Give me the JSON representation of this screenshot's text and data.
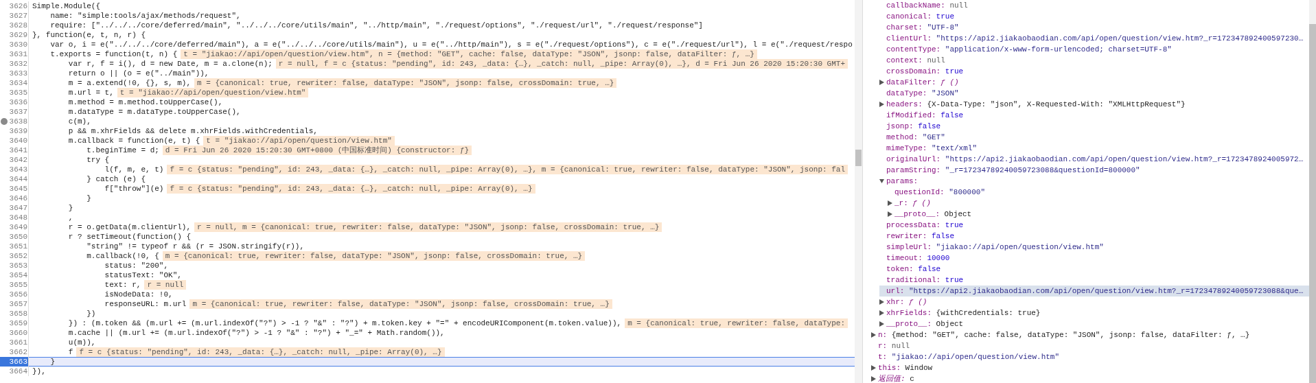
{
  "editor": {
    "lines": [
      {
        "number": "3626",
        "code": "Simple.Module({",
        "breakpoint": false,
        "current": false
      },
      {
        "number": "3627",
        "code": "    name: \"simple:tools/ajax/methods/request\",",
        "breakpoint": false,
        "current": false
      },
      {
        "number": "3628",
        "code": "    require: [\"../../../core/deferred/main\", \"../../../core/utils/main\", \"../http/main\", \"./request/options\", \"./request/url\", \"./request/response\"]",
        "breakpoint": false,
        "current": false
      },
      {
        "number": "3629",
        "code": "}, function(e, t, n, r) {",
        "breakpoint": false,
        "current": false
      },
      {
        "number": "3630",
        "code": "    var o, i = e(\"../../../core/deferred/main\"), a = e(\"../../../core/utils/main\"), u = e(\"../http/main\"), s = e(\"./request/options\"), c = e(\"./request/url\"), l = e(\"./request/respo",
        "breakpoint": false,
        "current": false
      },
      {
        "number": "3631",
        "code": "    t.exports = function(t, n) {",
        "note": "t = \"jiakao://api/open/question/view.htm\", n = {method: \"GET\", cache: false, dataType: \"JSON\", jsonp: false, dataFilter: ƒ, …}",
        "breakpoint": false,
        "current": false
      },
      {
        "number": "3632",
        "code": "        var r, f = i(), d = new Date, m = a.clone(n);",
        "note": "r = null, f = c {status: \"pending\", id: 243, _data: {…}, _catch: null, _pipe: Array(0), …}, d = Fri Jun 26 2020 15:20:30 GMT+",
        "breakpoint": false,
        "current": false
      },
      {
        "number": "3633",
        "code": "        return o || (o = e(\"../main\")),",
        "breakpoint": false,
        "current": false
      },
      {
        "number": "3634",
        "code": "        m = a.extend(!0, {}, s, m),",
        "note": "m = {canonical: true, rewriter: false, dataType: \"JSON\", jsonp: false, crossDomain: true, …}",
        "breakpoint": false,
        "current": false
      },
      {
        "number": "3635",
        "code": "        m.url = t,",
        "note": "t = \"jiakao://api/open/question/view.htm\"",
        "breakpoint": false,
        "current": false
      },
      {
        "number": "3636",
        "code": "        m.method = m.method.toUpperCase(),",
        "breakpoint": false,
        "current": false
      },
      {
        "number": "3637",
        "code": "        m.dataType = m.dataType.toUpperCase(),",
        "breakpoint": false,
        "current": false
      },
      {
        "number": "3638",
        "code": "        c(m),",
        "breakpoint": true,
        "current": false
      },
      {
        "number": "3639",
        "code": "        p && m.xhrFields && delete m.xhrFields.withCredentials,",
        "breakpoint": false,
        "current": false
      },
      {
        "number": "3640",
        "code": "        m.callback = function(e, t) {",
        "note": "t = \"jiakao://api/open/question/view.htm\"",
        "breakpoint": false,
        "current": false
      },
      {
        "number": "3641",
        "code": "            t.beginTime = d;",
        "note": "d = Fri Jun 26 2020 15:20:30 GMT+0800 (中国标准时间) {constructor: ƒ}",
        "breakpoint": false,
        "current": false
      },
      {
        "number": "3642",
        "code": "            try {",
        "breakpoint": false,
        "current": false
      },
      {
        "number": "3643",
        "code": "                l(f, m, e, t)",
        "note": "f = c {status: \"pending\", id: 243, _data: {…}, _catch: null, _pipe: Array(0), …}, m = {canonical: true, rewriter: false, dataType: \"JSON\", jsonp: fal",
        "breakpoint": false,
        "current": false
      },
      {
        "number": "3644",
        "code": "            } catch (e) {",
        "breakpoint": false,
        "current": false
      },
      {
        "number": "3645",
        "code": "                f[\"throw\"](e)",
        "note": "f = c {status: \"pending\", id: 243, _data: {…}, _catch: null, _pipe: Array(0), …}",
        "breakpoint": false,
        "current": false
      },
      {
        "number": "3646",
        "code": "            }",
        "breakpoint": false,
        "current": false
      },
      {
        "number": "3647",
        "code": "        }",
        "breakpoint": false,
        "current": false
      },
      {
        "number": "3648",
        "code": "        ,",
        "breakpoint": false,
        "current": false
      },
      {
        "number": "3649",
        "code": "        r = o.getData(m.clientUrl),",
        "note": "r = null, m = {canonical: true, rewriter: false, dataType: \"JSON\", jsonp: false, crossDomain: true, …}",
        "breakpoint": false,
        "current": false
      },
      {
        "number": "3650",
        "code": "        r ? setTimeout(function() {",
        "breakpoint": false,
        "current": false
      },
      {
        "number": "3651",
        "code": "            \"string\" != typeof r && (r = JSON.stringify(r)),",
        "breakpoint": false,
        "current": false
      },
      {
        "number": "3652",
        "code": "            m.callback(!0, {",
        "note": "m = {canonical: true, rewriter: false, dataType: \"JSON\", jsonp: false, crossDomain: true, …}",
        "breakpoint": false,
        "current": false
      },
      {
        "number": "3653",
        "code": "                status: \"200\",",
        "breakpoint": false,
        "current": false
      },
      {
        "number": "3654",
        "code": "                statusText: \"OK\",",
        "breakpoint": false,
        "current": false
      },
      {
        "number": "3655",
        "code": "                text: r,",
        "note": "r = null",
        "breakpoint": false,
        "current": false
      },
      {
        "number": "3656",
        "code": "                isNodeData: !0,",
        "breakpoint": false,
        "current": false
      },
      {
        "number": "3657",
        "code": "                responseURL: m.url",
        "note": "m = {canonical: true, rewriter: false, dataType: \"JSON\", jsonp: false, crossDomain: true, …}",
        "breakpoint": false,
        "current": false
      },
      {
        "number": "3658",
        "code": "            })",
        "breakpoint": false,
        "current": false
      },
      {
        "number": "3659",
        "code": "        }) : (m.token && (m.url += (m.url.indexOf(\"?\") > -1 ? \"&\" : \"?\") + m.token.key + \"=\" + encodeURIComponent(m.token.value)),",
        "note": "m = {canonical: true, rewriter: false, dataType:",
        "breakpoint": false,
        "current": false
      },
      {
        "number": "3660",
        "code": "        m.cache || (m.url += (m.url.indexOf(\"?\") > -1 ? \"&\" : \"?\") + \"_=\" + Math.random()),",
        "breakpoint": false,
        "current": false
      },
      {
        "number": "3661",
        "code": "        u(m)),",
        "breakpoint": false,
        "current": false
      },
      {
        "number": "3662",
        "code": "        f",
        "note": "f = c {status: \"pending\", id: 243, _data: {…}, _catch: null, _pipe: Array(0), …}",
        "breakpoint": false,
        "current": false
      },
      {
        "number": "3663",
        "code": "    }",
        "breakpoint": false,
        "current": true
      },
      {
        "number": "3664",
        "code": "}),",
        "breakpoint": false,
        "current": false
      }
    ]
  },
  "scope": {
    "items": [
      {
        "children": [
          {
            "key": "callbackName:",
            "value": "null",
            "kind": "null",
            "selected": false
          },
          {
            "key": "canonical:",
            "value": "true",
            "kind": "bool",
            "selected": false
          },
          {
            "key": "charset:",
            "value": "\"UTF-8\"",
            "kind": "string",
            "selected": false
          },
          {
            "key": "clientUrl:",
            "value": "\"https://api2.jiakaobaodian.com/api/open/question/view.htm?_r=172347892400597230…",
            "kind": "string",
            "selected": false
          },
          {
            "key": "contentType:",
            "value": "\"application/x-www-form-urlencoded; charset=UTF-8\"",
            "kind": "string",
            "selected": false
          },
          {
            "key": "context:",
            "value": "null",
            "kind": "null",
            "selected": false
          },
          {
            "key": "crossDomain:",
            "value": "true",
            "kind": "bool",
            "selected": false
          },
          {
            "key": "dataFilter:",
            "value": "ƒ ()",
            "kind": "func",
            "selected": false,
            "expanded": false
          },
          {
            "key": "dataType:",
            "value": "\"JSON\"",
            "kind": "string",
            "selected": false
          },
          {
            "key": "headers:",
            "value": "{X-Data-Type: \"json\", X-Requested-With: \"XMLHttpRequest\"}",
            "kind": "object",
            "selected": false,
            "expanded": false
          },
          {
            "key": "ifModified:",
            "value": "false",
            "kind": "bool",
            "selected": false
          },
          {
            "key": "jsonp:",
            "value": "false",
            "kind": "bool",
            "selected": false
          },
          {
            "key": "method:",
            "value": "\"GET\"",
            "kind": "string",
            "selected": false
          },
          {
            "key": "mimeType:",
            "value": "\"text/xml\"",
            "kind": "string",
            "selected": false
          },
          {
            "key": "originalUrl:",
            "value": "\"https://api2.jiakaobaodian.com/api/open/question/view.htm?_r=1723478924005972…",
            "kind": "string",
            "selected": false
          },
          {
            "key": "paramString:",
            "value": "\"_r=17234789240059723088&questionId=800000\"",
            "kind": "string",
            "selected": false
          },
          {
            "key": "params:",
            "selected": false,
            "expanded": true,
            "children": [
              {
                "key": "questionId:",
                "value": "\"800000\"",
                "kind": "string",
                "selected": false
              },
              {
                "key": "_r:",
                "value": "ƒ ()",
                "kind": "func",
                "selected": false,
                "expanded": false
              },
              {
                "key": "__proto__:",
                "value": "Object",
                "kind": "object",
                "selected": false,
                "expanded": false
              }
            ]
          },
          {
            "key": "processData:",
            "value": "true",
            "kind": "bool",
            "selected": false
          },
          {
            "key": "rewriter:",
            "value": "false",
            "kind": "bool",
            "selected": false
          },
          {
            "key": "simpleUrl:",
            "value": "\"jiakao://api/open/question/view.htm\"",
            "kind": "string",
            "selected": false
          },
          {
            "key": "timeout:",
            "value": "10000",
            "kind": "number",
            "selected": false
          },
          {
            "key": "token:",
            "value": "false",
            "kind": "bool",
            "selected": false
          },
          {
            "key": "traditional:",
            "value": "true",
            "kind": "bool",
            "selected": false
          },
          {
            "key": "url:",
            "value": "\"https://api2.jiakaobaodian.com/api/open/question/view.htm?_r=17234789240059723088&que…",
            "kind": "string",
            "selected": true
          },
          {
            "key": "xhr:",
            "value": "ƒ ()",
            "kind": "func",
            "selected": false,
            "expanded": false
          },
          {
            "key": "xhrFields:",
            "value": "{withCredentials: true}",
            "kind": "object",
            "selected": false,
            "expanded": false
          },
          {
            "key": "__proto__:",
            "value": "Object",
            "kind": "object",
            "selected": false,
            "expanded": false
          }
        ]
      },
      {
        "key": "n:",
        "value": "{method: \"GET\", cache: false, dataType: \"JSON\", jsonp: false, dataFilter: ƒ, …}",
        "kind": "object",
        "selected": false,
        "expanded": false
      },
      {
        "key": "r:",
        "value": "null",
        "kind": "null",
        "selected": false
      },
      {
        "key": "t:",
        "value": "\"jiakao://api/open/question/view.htm\"",
        "kind": "string",
        "selected": false
      },
      {
        "key": "this:",
        "value": "Window",
        "kind": "object",
        "selected": false,
        "expanded": false
      },
      {
        "key": "返回值:",
        "value": "c",
        "kind": "object",
        "italic": true,
        "selected": false,
        "expanded": false
      }
    ]
  }
}
